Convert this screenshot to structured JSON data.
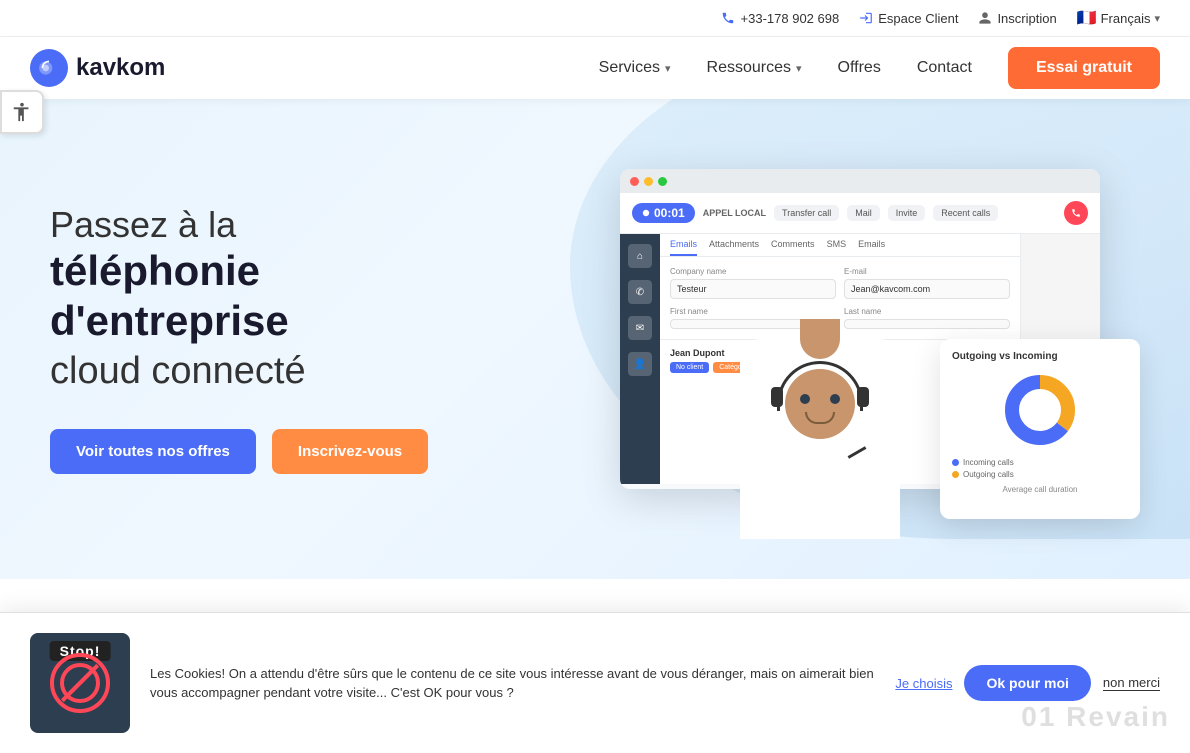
{
  "topbar": {
    "phone": "+33-178 902 698",
    "espace_client": "Espace Client",
    "inscription": "Inscription",
    "langue": "Français"
  },
  "nav": {
    "logo_text": "kavkom",
    "services_label": "Services",
    "ressources_label": "Ressources",
    "offres_label": "Offres",
    "contact_label": "Contact",
    "cta_label": "Essai gratuit"
  },
  "hero": {
    "title_line1": "Passez à la",
    "title_line2": "téléphonie d'entreprise",
    "title_line3": "cloud connecté",
    "btn_offers": "Voir toutes nos offres",
    "btn_signup": "Inscrivez-vous"
  },
  "dashboard": {
    "call_timer": "00:01",
    "call_label": "APPEL LOCAL",
    "btn_transfer": "Transfer call",
    "btn_mail": "Mail",
    "btn_invite": "Invite",
    "btn_recent": "Recent calls",
    "tabs": [
      "Emails",
      "Attachments",
      "Comments",
      "SMS",
      "Emails"
    ],
    "form": {
      "company_label": "Company name",
      "email_label": "E-mail",
      "first_name_label": "First name",
      "last_name_label": "Last name",
      "company_value": "Testeur",
      "email_value": "Jean@kavcom.com"
    },
    "contact_name": "Jean Dupont",
    "chart_title": "Outgoing vs Incoming",
    "legend_incoming": "Incoming calls",
    "legend_outgoing": "Outgoing calls",
    "avg_duration_label": "Average call duration"
  },
  "cookie": {
    "stop_label": "Stop!",
    "message": "Les Cookies! On a attendu d'être sûrs que le contenu de ce site vous intéresse avant de vous déranger, mais on aimerait bien vous accompagner pendant votre visite... C'est OK pour vous ?",
    "btn_choose": "Je choisis",
    "btn_ok": "Ok pour moi",
    "btn_decline": "non merci"
  },
  "colors": {
    "primary": "#4a6cf7",
    "secondary": "#ff8c42",
    "cta": "#ff6b35",
    "dark": "#1a1a2e"
  }
}
